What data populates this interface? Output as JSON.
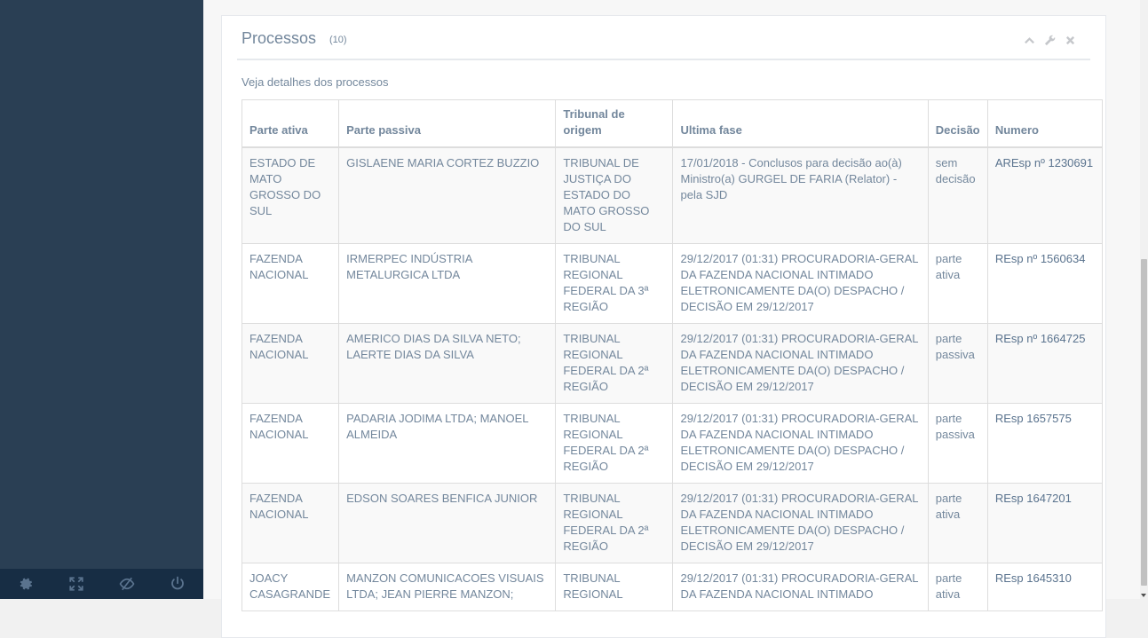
{
  "panel": {
    "title": "Processos",
    "count": "(10)",
    "subtitle": "Veja detalhes dos processos"
  },
  "table": {
    "headers": [
      "Parte ativa",
      "Parte passiva",
      "Tribunal de origem",
      "Ultima fase",
      "Decisão",
      "Numero"
    ],
    "rows": [
      [
        "ESTADO DE MATO GROSSO DO SUL",
        "GISLAENE MARIA CORTEZ BUZZIO",
        "TRIBUNAL DE JUSTIÇA DO ESTADO DO MATO GROSSO DO SUL",
        "17/01/2018 - Conclusos para decisão ao(à) Ministro(a) GURGEL DE FARIA (Relator) - pela SJD",
        "sem decisão",
        "AREsp nº 1230691"
      ],
      [
        "FAZENDA NACIONAL",
        "IRMERPEC INDÚSTRIA METALURGICA LTDA",
        "TRIBUNAL REGIONAL FEDERAL DA 3ª REGIÃO",
        "29/12/2017 (01:31) PROCURADORIA-GERAL DA FAZENDA NACIONAL INTIMADO ELETRONICAMENTE DA(O) DESPACHO / DECISÃO EM 29/12/2017",
        "parte ativa",
        "REsp nº 1560634"
      ],
      [
        "FAZENDA NACIONAL",
        "AMERICO DIAS DA SILVA NETO; LAERTE DIAS DA SILVA",
        "TRIBUNAL REGIONAL FEDERAL DA 2ª REGIÃO",
        "29/12/2017 (01:31) PROCURADORIA-GERAL DA FAZENDA NACIONAL INTIMADO ELETRONICAMENTE DA(O) DESPACHO / DECISÃO EM 29/12/2017",
        "parte passiva",
        "REsp nº 1664725"
      ],
      [
        "FAZENDA NACIONAL",
        "PADARIA JODIMA LTDA; MANOEL ALMEIDA",
        "TRIBUNAL REGIONAL FEDERAL DA 2ª REGIÃO",
        "29/12/2017 (01:31) PROCURADORIA-GERAL DA FAZENDA NACIONAL INTIMADO ELETRONICAMENTE DA(O) DESPACHO / DECISÃO EM 29/12/2017",
        "parte passiva",
        "REsp 1657575"
      ],
      [
        "FAZENDA NACIONAL",
        "EDSON SOARES BENFICA JUNIOR",
        "TRIBUNAL REGIONAL FEDERAL DA 2ª REGIÃO",
        "29/12/2017 (01:31) PROCURADORIA-GERAL DA FAZENDA NACIONAL INTIMADO ELETRONICAMENTE DA(O) DESPACHO / DECISÃO EM 29/12/2017",
        "parte ativa",
        "REsp 1647201"
      ],
      [
        "JOACY CASAGRANDE",
        "MANZON COMUNICACOES VISUAIS LTDA; JEAN PIERRE MANZON;",
        "TRIBUNAL REGIONAL",
        "29/12/2017 (01:31) PROCURADORIA-GERAL DA FAZENDA NACIONAL INTIMADO",
        "parte ativa",
        "REsp 1645310"
      ]
    ]
  },
  "footer_icons": [
    "gear-icon",
    "fullscreen-icon",
    "eye-slash-icon",
    "power-icon"
  ],
  "tool_icons": [
    "chevron-up-icon",
    "wrench-icon",
    "close-icon"
  ],
  "colors": {
    "sidebar": "#2a3f54",
    "sidebar_footer": "#172d44",
    "text": "#73879c"
  }
}
